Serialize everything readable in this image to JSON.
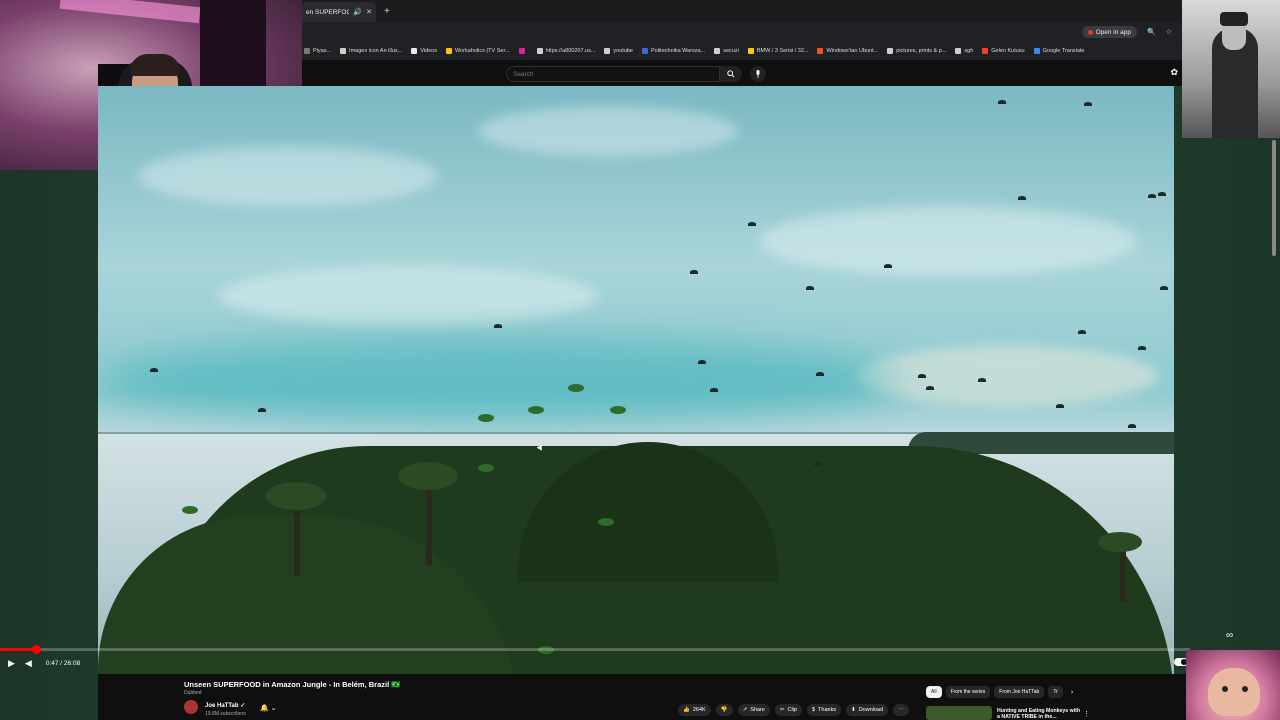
{
  "browser": {
    "tab_title": "en SUPERFOOD",
    "new_tab_symbol": "+",
    "open_in_app": "Open in app",
    "bookmarks": [
      {
        "label": "Piyas...",
        "color": "#777777"
      },
      {
        "label": "Images icon An illus...",
        "color": "#cfcfcf"
      },
      {
        "label": "Videos",
        "color": "#e8e8e8"
      },
      {
        "label": "Workaholics (TV Ser...",
        "color": "#f5c518"
      },
      {
        "label": "",
        "color": "#d6249f"
      },
      {
        "label": "https://a800207.us...",
        "color": "#cfcfcf"
      },
      {
        "label": "youtube",
        "color": "#cfcfcf"
      },
      {
        "label": "Politechnika Warsza...",
        "color": "#3b6bd6"
      },
      {
        "label": "secuzi",
        "color": "#cfcfcf"
      },
      {
        "label": "BMW / 3 Serisi / 32...",
        "color": "#f5d000"
      },
      {
        "label": "Windows'tan Ubunt...",
        "color": "#e95420"
      },
      {
        "label": "pictures, prints & p...",
        "color": "#cfcfcf"
      },
      {
        "label": "sgh",
        "color": "#cfcfcf"
      },
      {
        "label": "Gelen Kutusu",
        "color": "#ea4335"
      },
      {
        "label": "Google Translate",
        "color": "#4285f4"
      }
    ]
  },
  "youtube": {
    "search_placeholder": "Search"
  },
  "player": {
    "time": "0:47 / 26:08",
    "progress_fraction": 0.03
  },
  "video": {
    "title": "Unseen SUPERFOOD in Amazon Jungle - In Belém, Brazil 🇧🇷",
    "dubbed": "Dubbed",
    "channel": "Joe HaTTab ✓",
    "subscribers": "19.8M subscribers",
    "actions": [
      {
        "icon": "👍",
        "label": "264K",
        "name": "like-button"
      },
      {
        "icon": "👎",
        "label": "",
        "name": "dislike-button"
      },
      {
        "icon": "↗",
        "label": "Share",
        "name": "share-button"
      },
      {
        "icon": "✂",
        "label": "Clip",
        "name": "clip-button"
      },
      {
        "icon": "$",
        "label": "Thanks",
        "name": "thanks-button"
      },
      {
        "icon": "⬇",
        "label": "Download",
        "name": "download-button"
      },
      {
        "icon": "⋯",
        "label": "",
        "name": "more-actions-button"
      }
    ]
  },
  "recommendations": {
    "chips": [
      "All",
      "From the series",
      "From Joe HaTTab",
      "Tr"
    ],
    "first_title": "Hunting and Eating Monkeys with a NATIVE TRIBE in the..."
  },
  "colors": {
    "accent": "#ff0000",
    "chrome_bg": "#202124",
    "yt_bg": "#0f0f0f"
  }
}
